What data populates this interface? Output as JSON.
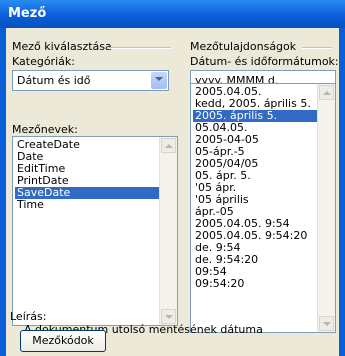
{
  "window": {
    "title": "Mező"
  },
  "left": {
    "group_label": "Mező kiválasztása",
    "category_label": "Kategóriák:",
    "category_value": "Dátum és idő",
    "fieldnames_label": "Mezőnevek:",
    "fieldnames": [
      "CreateDate",
      "Date",
      "EditTime",
      "PrintDate",
      "SaveDate",
      "Time"
    ],
    "selected_index": 4
  },
  "right": {
    "group_label": "Mezőtulajdonságok",
    "formats_label": "Dátum- és időformátumok:",
    "format_value": "yyyy. MMMM d.",
    "formats": [
      "2005.04.05.",
      "kedd, 2005. április 5.",
      "2005. április 5.",
      "05.04.05.",
      "2005-04-05",
      "05-ápr.-5",
      "2005/04/05",
      "05. ápr. 5.",
      "'05 ápr.",
      "'05 április",
      "ápr.-05",
      "2005.04.05. 9:54",
      "2005.04.05. 9:54:20",
      "de. 9:54",
      "de. 9:54:20",
      "09:54",
      "09:54:20"
    ],
    "selected_index": 2
  },
  "description": {
    "label": "Leírás:",
    "text": "A dokumentum utolsó mentésének dátuma"
  },
  "buttons": {
    "field_codes": "Mezőkódok"
  },
  "colors": {
    "title_bar": "#0a5fd8",
    "selection": "#316ac5",
    "background": "#ece9d8"
  }
}
